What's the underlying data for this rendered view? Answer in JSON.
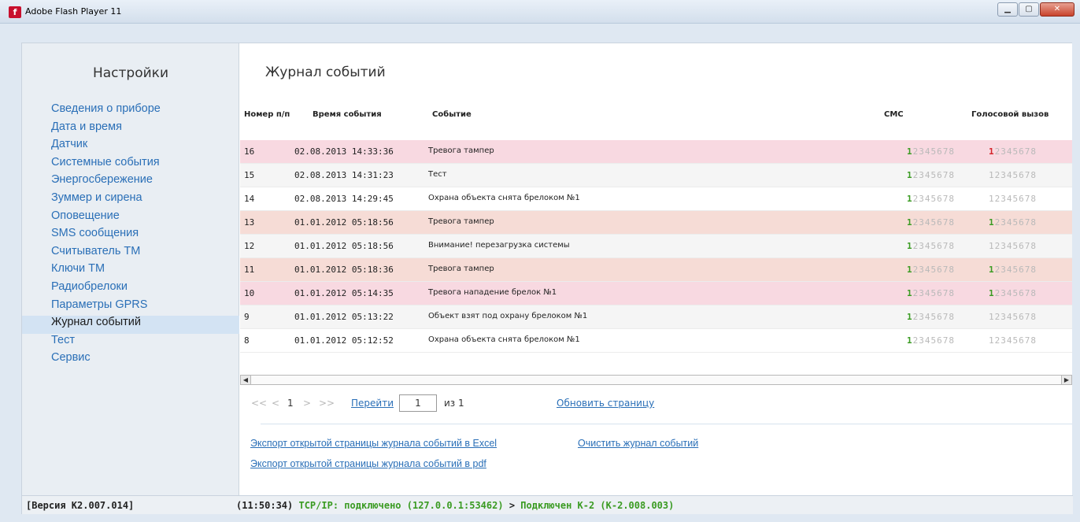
{
  "window": {
    "title": "Adobe Flash Player 11",
    "icon": "flash-icon",
    "controls": {
      "minimize": "▁",
      "maximize": "▢",
      "close": "✕"
    }
  },
  "sidebar": {
    "title": "Настройки",
    "items": [
      {
        "label": "Сведения о приборе",
        "active": false
      },
      {
        "label": "Дата и время",
        "active": false
      },
      {
        "label": "Датчик",
        "active": false
      },
      {
        "label": "Системные события",
        "active": false
      },
      {
        "label": "Энергосбережение",
        "active": false
      },
      {
        "label": "Зуммер и сирена",
        "active": false
      },
      {
        "label": "Оповещение",
        "active": false
      },
      {
        "label": "SMS сообщения",
        "active": false
      },
      {
        "label": "Считыватель ТМ",
        "active": false
      },
      {
        "label": "Ключи ТМ",
        "active": false
      },
      {
        "label": "Радиобрелоки",
        "active": false
      },
      {
        "label": "Параметры GPRS",
        "active": false
      },
      {
        "label": "Журнал событий",
        "active": true
      },
      {
        "label": "Тест",
        "active": false
      },
      {
        "label": "Сервис",
        "active": false
      }
    ]
  },
  "main": {
    "title": "Журнал событий",
    "columns": {
      "num": "Номер п/п",
      "time": "Время события",
      "event": "Событие",
      "sms": "СМС",
      "voice": "Голосовой вызов"
    },
    "rows": [
      {
        "num": "16",
        "time": "02.08.2013 14:33:36",
        "event": "Тревога тампер",
        "style": "alarm-pink",
        "sms_first": "1",
        "sms_first_color": "g",
        "sms_rest": "2345678",
        "voice_first": "1",
        "voice_first_color": "r",
        "voice_rest": "2345678"
      },
      {
        "num": "15",
        "time": "02.08.2013 14:31:23",
        "event": "Тест",
        "style": "plain",
        "sms_first": "1",
        "sms_first_color": "g",
        "sms_rest": "2345678",
        "voice_first": "1",
        "voice_first_color": "",
        "voice_rest": "2345678"
      },
      {
        "num": "14",
        "time": "02.08.2013 14:29:45",
        "event": "Охрана объекта снята брелоком №1",
        "style": "white",
        "sms_first": "1",
        "sms_first_color": "g",
        "sms_rest": "2345678",
        "voice_first": "1",
        "voice_first_color": "",
        "voice_rest": "2345678"
      },
      {
        "num": "13",
        "time": "01.01.2012 05:18:56",
        "event": "Тревога тампер",
        "style": "alarm-red",
        "sms_first": "1",
        "sms_first_color": "g",
        "sms_rest": "2345678",
        "voice_first": "1",
        "voice_first_color": "g",
        "voice_rest": "2345678"
      },
      {
        "num": "12",
        "time": "01.01.2012 05:18:56",
        "event": "Внимание! перезагрузка системы",
        "style": "plain",
        "sms_first": "1",
        "sms_first_color": "g",
        "sms_rest": "2345678",
        "voice_first": "1",
        "voice_first_color": "",
        "voice_rest": "2345678"
      },
      {
        "num": "11",
        "time": "01.01.2012 05:18:36",
        "event": "Тревога тампер",
        "style": "alarm-red",
        "sms_first": "1",
        "sms_first_color": "g",
        "sms_rest": "2345678",
        "voice_first": "1",
        "voice_first_color": "g",
        "voice_rest": "2345678"
      },
      {
        "num": "10",
        "time": "01.01.2012 05:14:35",
        "event": "Тревога нападение брелок №1",
        "style": "alarm-pink",
        "sms_first": "1",
        "sms_first_color": "g",
        "sms_rest": "2345678",
        "voice_first": "1",
        "voice_first_color": "g",
        "voice_rest": "2345678"
      },
      {
        "num": "9",
        "time": "01.01.2012 05:13:22",
        "event": "Объект взят под охрану брелоком №1",
        "style": "plain",
        "sms_first": "1",
        "sms_first_color": "g",
        "sms_rest": "2345678",
        "voice_first": "1",
        "voice_first_color": "",
        "voice_rest": "2345678"
      },
      {
        "num": "8",
        "time": "01.01.2012 05:12:52",
        "event": "Охрана объекта снята брелоком №1",
        "style": "white",
        "sms_first": "1",
        "sms_first_color": "g",
        "sms_rest": "2345678",
        "voice_first": "1",
        "voice_first_color": "",
        "voice_rest": "2345678"
      }
    ],
    "pager": {
      "first": "<<",
      "prev": "<",
      "current": "1",
      "next": ">",
      "last": ">>",
      "goto_label": "Перейти",
      "goto_value": "1",
      "of_label": "из 1",
      "refresh_label": "Обновить страницу"
    },
    "links": {
      "export_excel": "Экспорт открытой страницы журнала событий в Excel",
      "clear_log": "Очистить журнал событий",
      "export_pdf": "Экспорт открытой страницы журнала событий в pdf"
    }
  },
  "status": {
    "version": "[Версия К2.007.014]",
    "time": "(11:50:34)",
    "tcp": "TCP/IP: подключено (127.0.0.1:53462)",
    "arrow": ">",
    "device": "Подключен К-2 (К-2.008.003)"
  },
  "colors": {
    "link": "#2a6fb7",
    "green": "#3a9b22",
    "red": "#d4242a",
    "alarm_row": "#f8d9e1"
  }
}
